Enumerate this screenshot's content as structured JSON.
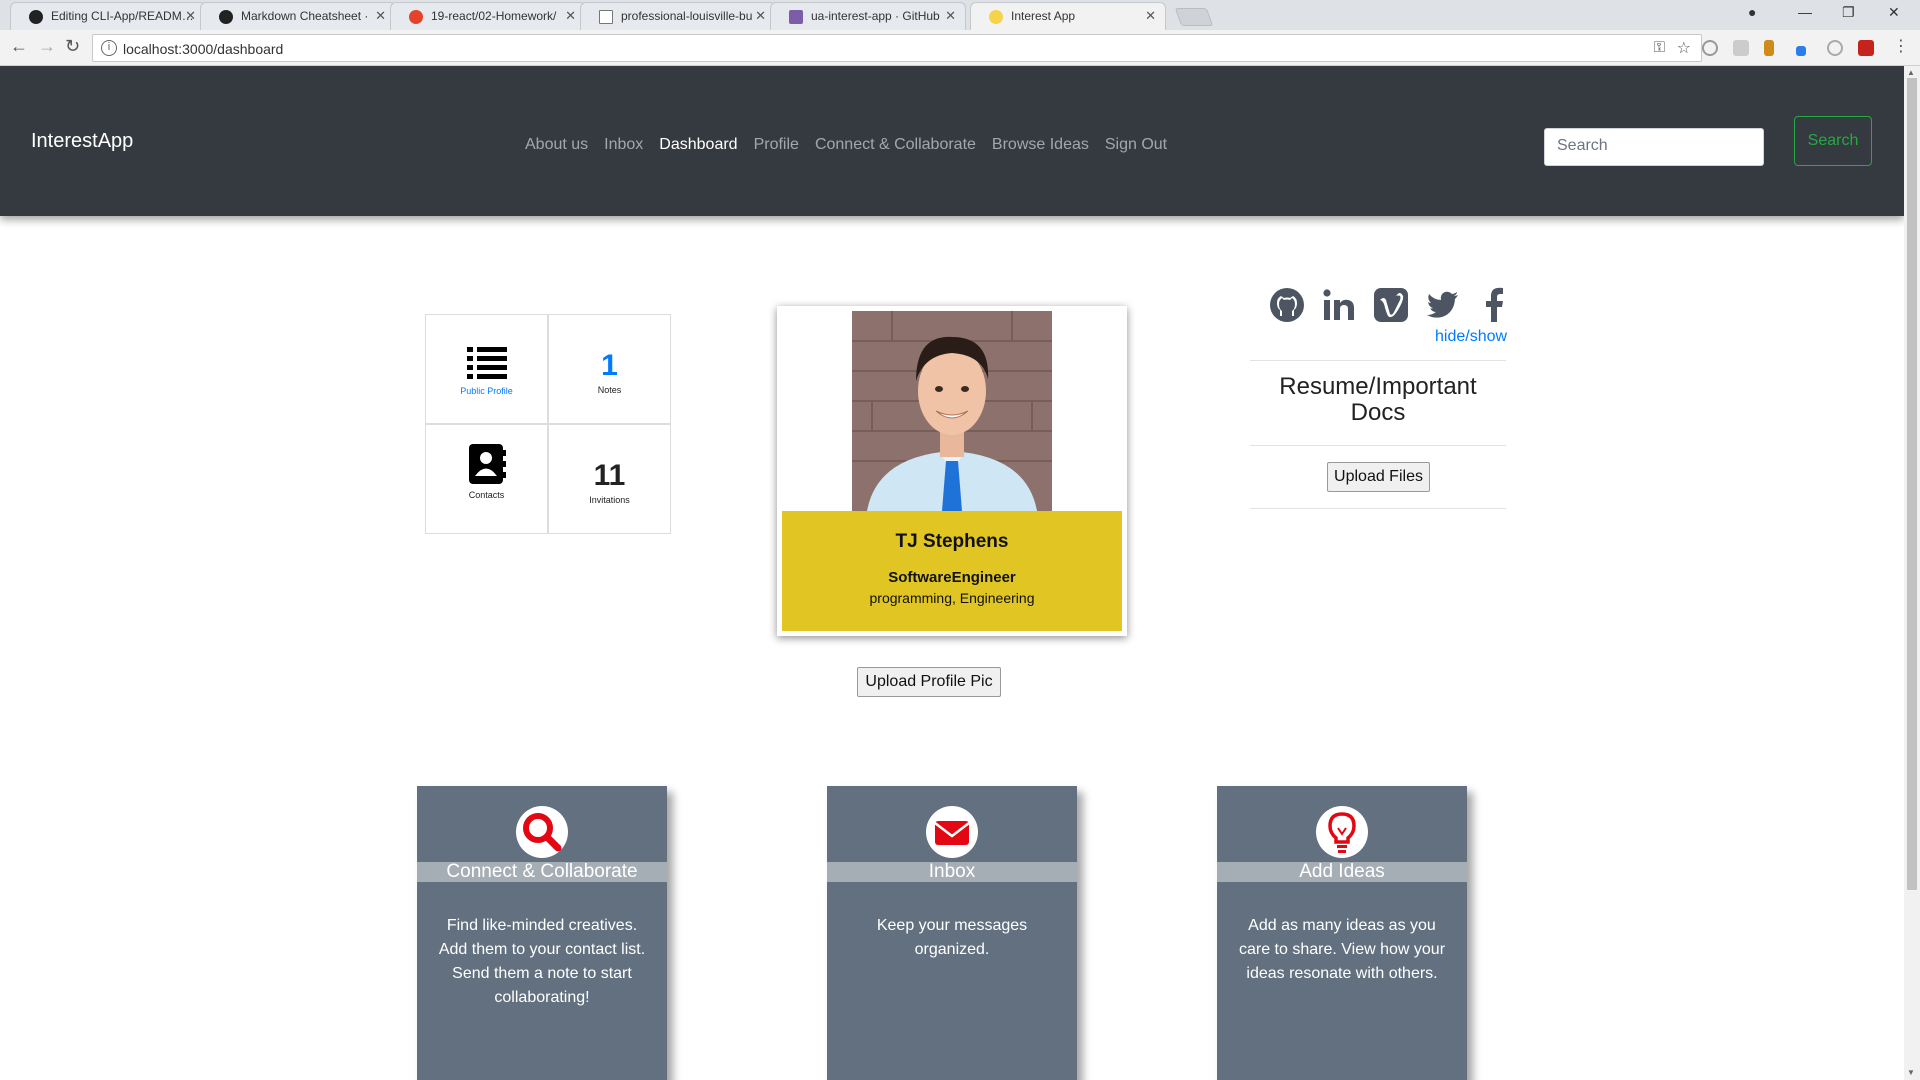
{
  "browser": {
    "tabs": [
      {
        "title": "Editing CLI-App/READM…"
      },
      {
        "title": "Markdown Cheatsheet ·"
      },
      {
        "title": "19-react/02-Homework/"
      },
      {
        "title": "professional-louisville-bu"
      },
      {
        "title": "ua-interest-app · GitHub"
      },
      {
        "title": "Interest App"
      }
    ],
    "url": "localhost:3000/dashboard"
  },
  "nav": {
    "brand": "InterestApp",
    "links": [
      "About us",
      "Inbox",
      "Dashboard",
      "Profile",
      "Connect & Collaborate",
      "Browse Ideas",
      "Sign Out"
    ],
    "active_link": "Dashboard",
    "search_placeholder": "Search",
    "search_button": "Search"
  },
  "stats": {
    "public_profile_label": "Public Profile",
    "notes_count": "1",
    "notes_label": "Notes",
    "contacts_label": "Contacts",
    "invitations_count": "11",
    "invitations_label": "Invitations"
  },
  "profile": {
    "name": "TJ Stephens",
    "title": "SoftwareEngineer",
    "tags": "programming, Engineering",
    "upload_button": "Upload Profile Pic",
    "band_color": "#e1c623"
  },
  "sidebar": {
    "social_icons": [
      "github-icon",
      "linkedin-icon",
      "vimeo-icon",
      "twitter-icon",
      "facebook-icon"
    ],
    "hide_show": "hide/show",
    "docs_title": "Resume/Important Docs",
    "upload_files": "Upload Files"
  },
  "features": [
    {
      "title": "Connect & Collaborate",
      "icon": "search-icon",
      "description": "Find like-minded creatives. Add them to your contact list. Send them a note to start collaborating!"
    },
    {
      "title": "Inbox",
      "icon": "envelope-icon",
      "description": "Keep your messages organized."
    },
    {
      "title": "Add Ideas",
      "icon": "lightbulb-icon",
      "description": "Add as many ideas as you care to share. View how your ideas resonate with others."
    }
  ],
  "colors": {
    "navbar": "#343a40",
    "feature_card": "#627080",
    "accent_red": "#e30613",
    "link_blue": "#007bff",
    "search_green": "#28a745"
  }
}
